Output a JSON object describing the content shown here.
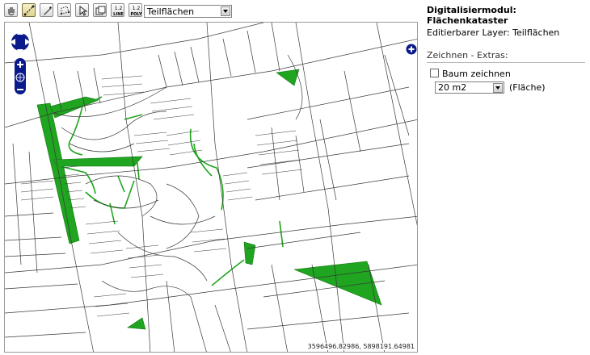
{
  "toolbar": {
    "buttons": [
      {
        "name": "pan-hand-icon"
      },
      {
        "name": "draw-line-icon"
      },
      {
        "name": "edit-pen-icon"
      },
      {
        "name": "draw-polygon-icon"
      },
      {
        "name": "select-arrow-icon"
      },
      {
        "name": "copy-icon"
      },
      {
        "name": "measure-line-icon",
        "label": "LINE",
        "num": "1.2"
      },
      {
        "name": "measure-poly-icon",
        "label": "POLY",
        "num": "1.2"
      }
    ],
    "layer_select": {
      "value": "Teilflächen"
    }
  },
  "map": {
    "coordinates": "3596496.82986, 5898191.64981",
    "feature_color": "#1fa51f",
    "line_color": "#3a3a3a",
    "nav_color": "#0a1a8a"
  },
  "panel": {
    "title": "Digitalisiermodul: Flächenkataster",
    "layer_line": "Editierbarer Layer: Teilflächen",
    "extras_heading": "Zeichnen - Extras:",
    "tree_checkbox_label": "Baum zeichnen",
    "tree_size_value": "20 m2",
    "tree_size_unit": "(Fläche)"
  }
}
